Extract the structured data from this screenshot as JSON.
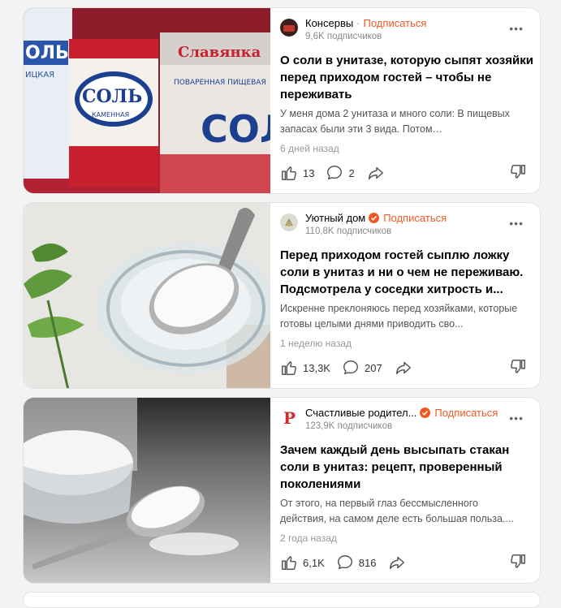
{
  "feed": {
    "cards": [
      {
        "channel": "Консервы",
        "subscribe": "Подписаться",
        "subscribers": "9,6K подписчиков",
        "title": "О соли в унитазе, которую сыпят хозяйки перед приходом гостей – чтобы не переживать",
        "excerpt": "У меня дома 2 унитаза и много соли: В пищевых запасах были эти 3 вида. Потом…",
        "date": "6 дней назад",
        "likes": "13",
        "comments": "2",
        "image_labels": {
          "brand": "СОЛЬ",
          "kind": "КАМЕННАЯ",
          "left": "ОЛЬ",
          "left_sub": "ИЦКАЯ",
          "right_brand": "Славянка",
          "right_sub": "ПОВАРЕННАЯ ПИЩЕВАЯ",
          "right_big": "СОЛ"
        }
      },
      {
        "channel": "Уютный дом",
        "subscribe": "Подписаться",
        "subscribers": "110,8K подписчиков",
        "title": "Перед приходом гостей сыплю ложку соли в унитаз и ни о чем не переживаю. Подсмотрела у соседки хитрость и...",
        "excerpt": "Искренне преклоняюсь перед хозяйками, которые готовы целыми днями приводить сво...",
        "date": "1 неделю назад",
        "likes": "13,3K",
        "comments": "207"
      },
      {
        "channel": "Счастливые родител...",
        "subscribe": "Подписаться",
        "subscribers": "123,9K подписчиков",
        "title": "Зачем каждый день высыпать стакан соли в унитаз: рецепт, проверенный поколениями",
        "excerpt": "От этого, на первый глаз бессмысленного действия, на самом деле есть большая польза....",
        "date": "2 года назад",
        "likes": "6,1K",
        "comments": "816",
        "avatar_letter": "P"
      }
    ]
  },
  "colors": {
    "accent": "#f05a22",
    "verified": "#f05a22"
  }
}
